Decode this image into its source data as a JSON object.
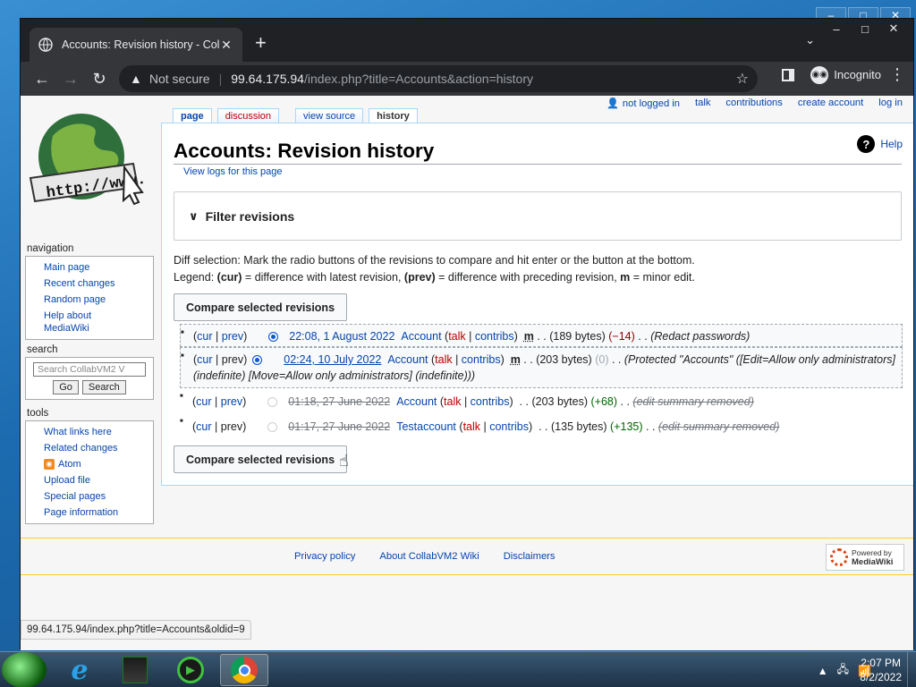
{
  "browser": {
    "tab_title": "Accounts: Revision history - Colla",
    "tab_close": "✕",
    "new_tab": "+",
    "omnibox_not_secure": "Not secure",
    "url_host": "99.64.175.94",
    "url_path": "/index.php?title=Accounts&action=history",
    "incognito_label": "Incognito"
  },
  "personal_tools": [
    "not logged in",
    "talk",
    "contributions",
    "create account",
    "log in"
  ],
  "page_tabs": {
    "page": "page",
    "discussion": "discussion",
    "view_source": "view source",
    "history": "history"
  },
  "content": {
    "help": "Help",
    "help_icon_glyph": "?",
    "title": "Accounts: Revision history",
    "view_logs": "View logs for this page",
    "filter_title": "Filter revisions",
    "diff_selection": "Diff selection: Mark the radio buttons of the revisions to compare and hit enter or the button at the bottom.",
    "legend_prefix": "Legend: ",
    "legend_cur": "(cur)",
    "legend_cur_desc": " = difference with latest revision, ",
    "legend_prev": "(prev)",
    "legend_prev_desc": " = difference with preceding revision, ",
    "legend_m": "m",
    "legend_m_desc": " = minor edit.",
    "compare_button": "Compare selected revisions"
  },
  "revisions": [
    {
      "cur": "cur",
      "prev": "prev",
      "date": "22:08, 1 August 2022",
      "user": "Account",
      "talk": "talk",
      "contribs": "contribs",
      "minor": "m",
      "size": ". . (189 bytes)",
      "change": "(−14)",
      "sep": ". .",
      "comment": "(Redact passwords)"
    },
    {
      "cur": "cur",
      "prev": "prev",
      "date": "02:24, 10 July 2022",
      "user": "Account",
      "talk": "talk",
      "contribs": "contribs",
      "minor": "m",
      "size": ". . (203 bytes)",
      "change": "(0)",
      "sep": ". .",
      "comment": "(Protected \"Accounts\" ([Edit=Allow only administrators] (indefinite) [Move=Allow only administrators] (indefinite)))",
      "comment_link": "Accounts"
    },
    {
      "cur": "cur",
      "prev": "prev",
      "date": "01:18, 27 June 2022",
      "user": "Account",
      "talk": "talk",
      "contribs": "contribs",
      "size": ". . (203 bytes)",
      "change": "(+68)",
      "sep": ". .",
      "comment": "(edit summary removed)"
    },
    {
      "cur": "cur",
      "prev": "prev",
      "date": "01:17, 27 June 2022",
      "user": "Testaccount",
      "talk": "talk",
      "contribs": "contribs",
      "size": ". . (135 bytes)",
      "change": "(+135)",
      "sep": ". .",
      "comment": "(edit summary removed)"
    }
  ],
  "sidebar": {
    "navigation_title": "navigation",
    "navigation": [
      "Main page",
      "Recent changes",
      "Random page",
      "Help about",
      "MediaWiki"
    ],
    "search_title": "search",
    "search_placeholder": "Search CollabVM2 V",
    "go": "Go",
    "search": "Search",
    "tools_title": "tools",
    "tools": [
      "What links here",
      "Related changes",
      "Atom",
      "Upload file",
      "Special pages",
      "Page information"
    ]
  },
  "footer": {
    "links": [
      "Privacy policy",
      "About CollabVM2 Wiki",
      "Disclaimers"
    ],
    "powered_by": "Powered by",
    "mediawiki": "MediaWiki"
  },
  "status_url": "99.64.175.94/index.php?title=Accounts&oldid=9",
  "clock": {
    "time": "2:07 PM",
    "date": "8/2/2022"
  }
}
